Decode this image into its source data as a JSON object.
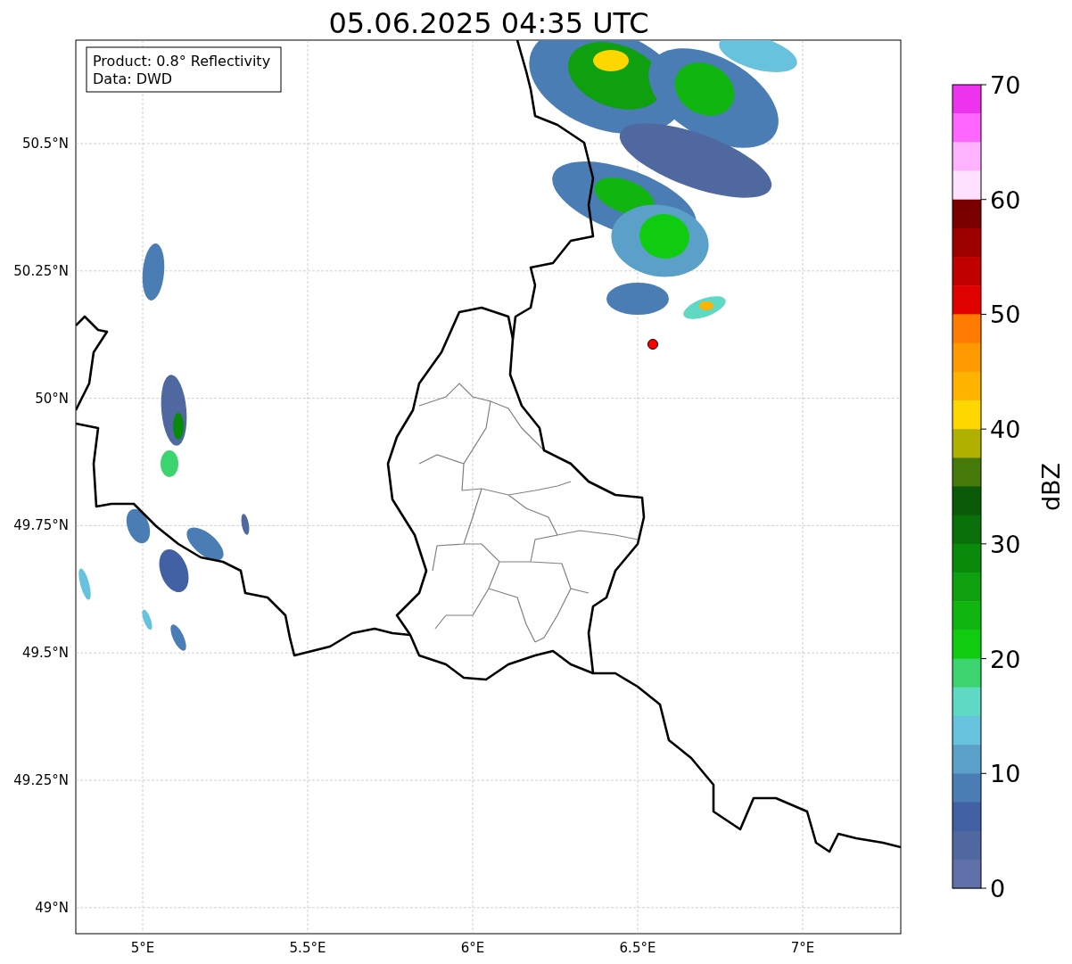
{
  "title": "05.06.2025 04:35 UTC",
  "info_box": {
    "lines": [
      "Product: 0.8° Reflectivity",
      "Data: DWD"
    ]
  },
  "map": {
    "lat_ticks": [
      "50.5°N",
      "50.25°N",
      "50°N",
      "49.75°N",
      "49.5°N",
      "49.25°N",
      "49°N"
    ],
    "lon_ticks": [
      "5°E",
      "5.5°E",
      "6°E",
      "6.5°E",
      "7°E"
    ]
  },
  "colorbar": {
    "label": "dBZ",
    "ticks": [
      "70",
      "60",
      "50",
      "40",
      "30",
      "20",
      "10",
      "0"
    ],
    "segments": [
      {
        "color": "#ee33ee"
      },
      {
        "color": "#ff66ff"
      },
      {
        "color": "#ffb3ff"
      },
      {
        "color": "#ffe0ff"
      },
      {
        "color": "#7a0000"
      },
      {
        "color": "#9e0000"
      },
      {
        "color": "#c00000"
      },
      {
        "color": "#e00000"
      },
      {
        "color": "#ff7a00"
      },
      {
        "color": "#ff9900"
      },
      {
        "color": "#ffb300"
      },
      {
        "color": "#ffd700"
      },
      {
        "color": "#b0b000"
      },
      {
        "color": "#457a0a"
      },
      {
        "color": "#0a5a0a"
      },
      {
        "color": "#0a700a"
      },
      {
        "color": "#0a8a0a"
      },
      {
        "color": "#0fa00f"
      },
      {
        "color": "#10b510"
      },
      {
        "color": "#10cc10"
      },
      {
        "color": "#3cd46e"
      },
      {
        "color": "#5fd8c4"
      },
      {
        "color": "#66c2dd"
      },
      {
        "color": "#5aa0c8"
      },
      {
        "color": "#4a7db4"
      },
      {
        "color": "#4260a4"
      },
      {
        "color": "#5068a0"
      },
      {
        "color": "#6070a8"
      }
    ]
  }
}
